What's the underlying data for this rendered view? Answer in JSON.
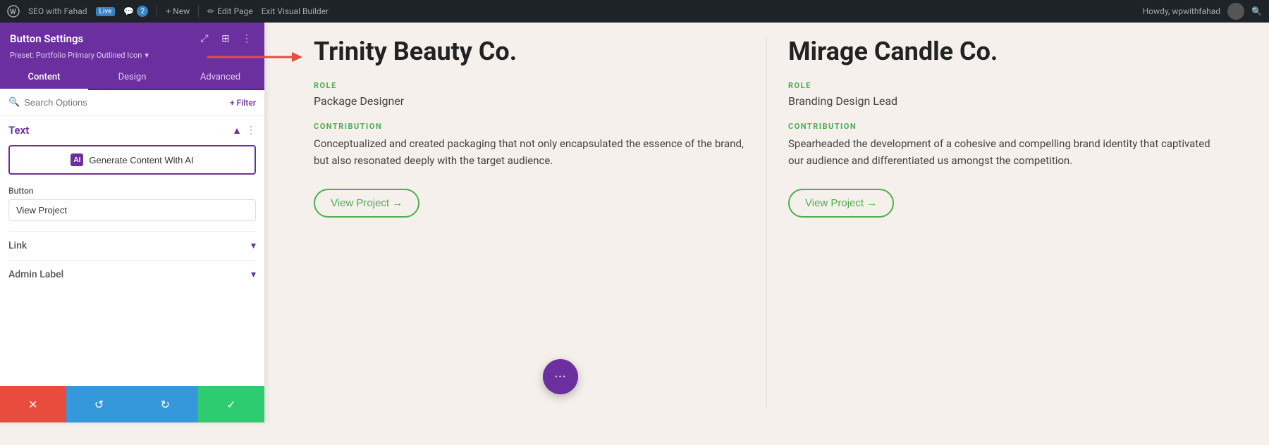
{
  "adminBar": {
    "logo": "W",
    "siteLabel": "SEO with Fahad",
    "liveBadge": "Live",
    "commentCount": "2",
    "commentIcon": "💬",
    "newLabel": "+ New",
    "editPage": "Edit Page",
    "exitBuilder": "Exit Visual Builder",
    "userLabel": "Howdy, wpwithfahad",
    "searchIcon": "🔍"
  },
  "panel": {
    "title": "Button Settings",
    "preset": "Preset: Portfolio Primary Outlined Icon",
    "presetDropdownIcon": "▾",
    "icons": {
      "resize": "⤢",
      "grid": "⊞",
      "dots": "⋮"
    },
    "tabs": [
      {
        "label": "Content",
        "active": true
      },
      {
        "label": "Design",
        "active": false
      },
      {
        "label": "Advanced",
        "active": false
      }
    ],
    "search": {
      "placeholder": "Search Options",
      "filterLabel": "+ Filter"
    },
    "textSection": {
      "title": "Text",
      "aiButton": "Generate Content With AI",
      "aiIconLabel": "AI"
    },
    "buttonSection": {
      "label": "Button",
      "value": "View Project"
    },
    "linkSection": {
      "title": "Link",
      "collapsed": true
    },
    "adminLabelSection": {
      "title": "Admin Label",
      "collapsed": true
    }
  },
  "bottomBar": {
    "deleteIcon": "✕",
    "undoIcon": "↺",
    "redoIcon": "↻",
    "saveIcon": "✓"
  },
  "content": {
    "card1": {
      "company": "Trinity Beauty Co.",
      "roleLabel": "ROLE",
      "role": "Package Designer",
      "contributionLabel": "CONTRIBUTION",
      "contribution": "Conceptualized and created packaging that not only encapsulated the essence of the brand, but also resonated deeply with the target audience.",
      "viewProject": "View Project →"
    },
    "card2": {
      "company": "Mirage Candle Co.",
      "roleLabel": "ROLE",
      "role": "Branding Design Lead",
      "contributionLabel": "CONTRIBUTION",
      "contribution": "Spearheaded the development of a cohesive and compelling brand identity that captivated our audience and differentiated us amongst the competition.",
      "viewProject": "View Project →"
    }
  },
  "fab": {
    "icon": "•••"
  }
}
